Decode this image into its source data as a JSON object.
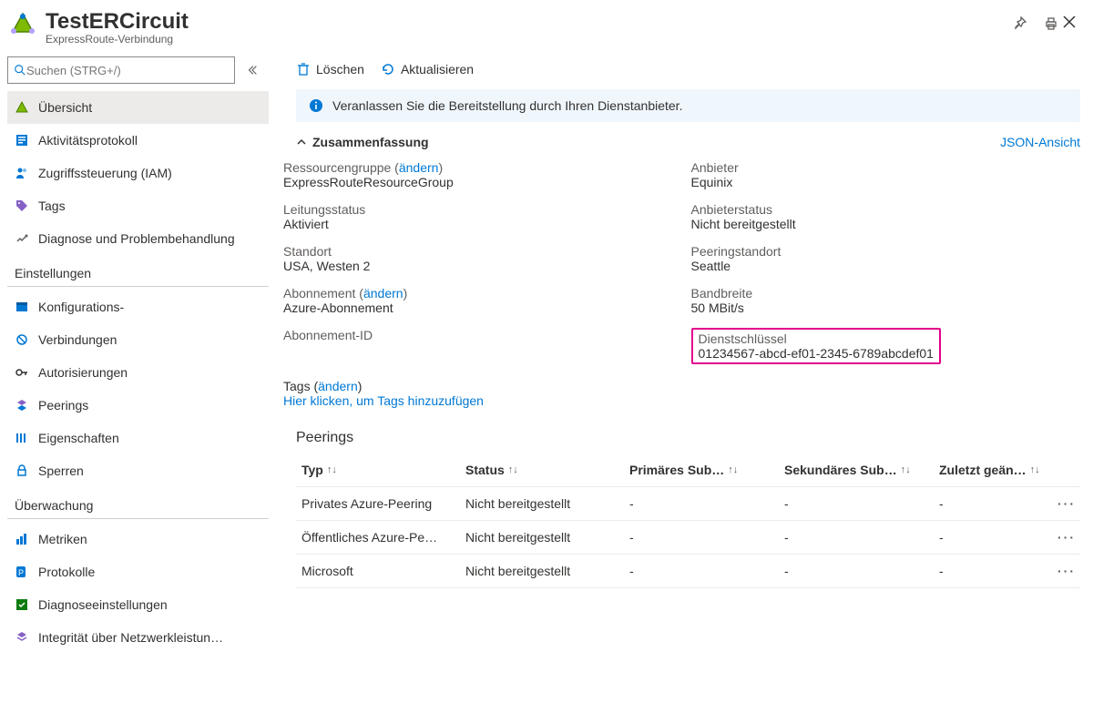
{
  "header": {
    "title": "TestERCircuit",
    "subtitle": "ExpressRoute-Verbindung"
  },
  "sidebar": {
    "search_placeholder": "Suchen (STRG+/)",
    "items_top": [
      {
        "icon": "triangle",
        "label": "Übersicht",
        "active": true
      },
      {
        "icon": "activity-log",
        "label": "Aktivitätsprotokoll"
      },
      {
        "icon": "iam",
        "label": "Zugriffssteuerung (IAM)"
      },
      {
        "icon": "tag",
        "label": "Tags"
      },
      {
        "icon": "diagnose",
        "label": "Diagnose und Problembehandlung"
      }
    ],
    "section_settings": "Einstellungen",
    "items_settings": [
      {
        "icon": "config",
        "label": "Konfigurations-"
      },
      {
        "icon": "connections",
        "label": "Verbindungen"
      },
      {
        "icon": "auth",
        "label": "Autorisierungen"
      },
      {
        "icon": "peerings",
        "label": "Peerings"
      },
      {
        "icon": "properties",
        "label": "Eigenschaften"
      },
      {
        "icon": "lock",
        "label": "Sperren"
      }
    ],
    "section_monitoring": "Überwachung",
    "items_monitoring": [
      {
        "icon": "metrics",
        "label": "Metriken"
      },
      {
        "icon": "logs",
        "label": "Protokolle"
      },
      {
        "icon": "diag-settings",
        "label": "Diagnoseeinstellungen"
      },
      {
        "icon": "network-health",
        "label": "Integrität über Netzwerkleistun…"
      }
    ]
  },
  "toolbar": {
    "delete": "Löschen",
    "refresh": "Aktualisieren"
  },
  "banner": "Veranlassen Sie die Bereitstellung durch Ihren Dienstanbieter.",
  "summary_section": {
    "title": "Zusammenfassung",
    "json_view": "JSON-Ansicht"
  },
  "summary": {
    "resource_group_label": "Ressourcengruppe",
    "change_link": "ändern",
    "resource_group_value": "ExpressRouteResourceGroup",
    "provider_label": "Anbieter",
    "provider_value": "Equinix",
    "circuit_status_label": "Leitungsstatus",
    "circuit_status_value": "Aktiviert",
    "provider_status_label": "Anbieterstatus",
    "provider_status_value": "Nicht bereitgestellt",
    "location_label": "Standort",
    "location_value": "USA, Westen 2",
    "peering_location_label": "Peeringstandort",
    "peering_location_value": "Seattle",
    "subscription_label": "Abonnement",
    "subscription_value": "Azure-Abonnement",
    "bandwidth_label": "Bandbreite",
    "bandwidth_value": "50 MBit/s",
    "subscription_id_label": "Abonnement-ID",
    "service_key_label": "Dienstschlüssel",
    "service_key_value": "01234567-abcd-ef01-2345-6789abcdef01"
  },
  "tags": {
    "label": "Tags",
    "add_link": "Hier klicken, um Tags hinzuzufügen"
  },
  "peerings": {
    "title": "Peerings",
    "columns": [
      "Typ",
      "Status",
      "Primäres Sub…",
      "Sekundäres Sub…",
      "Zuletzt geän…"
    ],
    "rows": [
      {
        "type": "Privates Azure-Peering",
        "status": "Nicht bereitgestellt",
        "primary": "-",
        "secondary": "-",
        "modified": "-"
      },
      {
        "type": "Öffentliches Azure-Pe…",
        "status": "Nicht bereitgestellt",
        "primary": "-",
        "secondary": "-",
        "modified": "-"
      },
      {
        "type": "Microsoft",
        "status": "Nicht bereitgestellt",
        "primary": "-",
        "secondary": "-",
        "modified": "-"
      }
    ]
  }
}
